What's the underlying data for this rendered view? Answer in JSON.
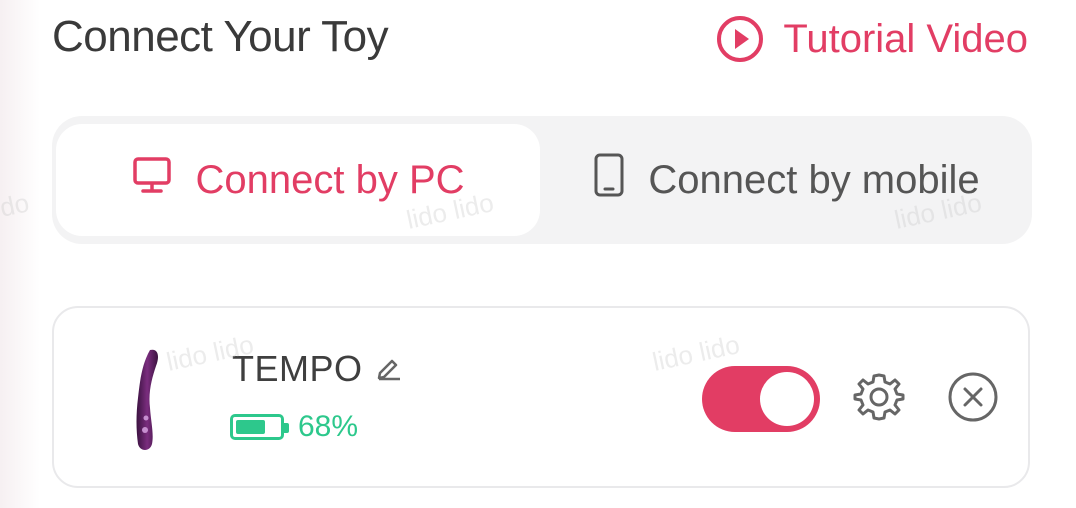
{
  "header": {
    "title": "Connect Your Toy",
    "tutorial_label": "Tutorial Video"
  },
  "connection_tabs": {
    "active": "pc",
    "pc_label": "Connect by PC",
    "mobile_label": "Connect by mobile"
  },
  "device": {
    "name": "TEMPO",
    "battery_text": "68%",
    "battery_level": 0.68,
    "enabled": true
  },
  "watermarks": [
    "lido lido",
    "lido lido",
    "lido lido",
    "lido lido",
    "lido",
    "do"
  ],
  "colors": {
    "accent": "#e23d64",
    "battery": "#2dc88c",
    "text_primary": "#3a3a3a",
    "text_muted": "#555555",
    "segment_bg": "#f3f3f4",
    "card_border": "#e9e9eb"
  },
  "icons": {
    "tutorial": "play-circle-icon",
    "pc": "monitor-icon",
    "mobile": "smartphone-icon",
    "edit": "pencil-icon",
    "settings": "gear-icon",
    "remove": "close-circle-icon",
    "device": "toy-device-icon"
  }
}
